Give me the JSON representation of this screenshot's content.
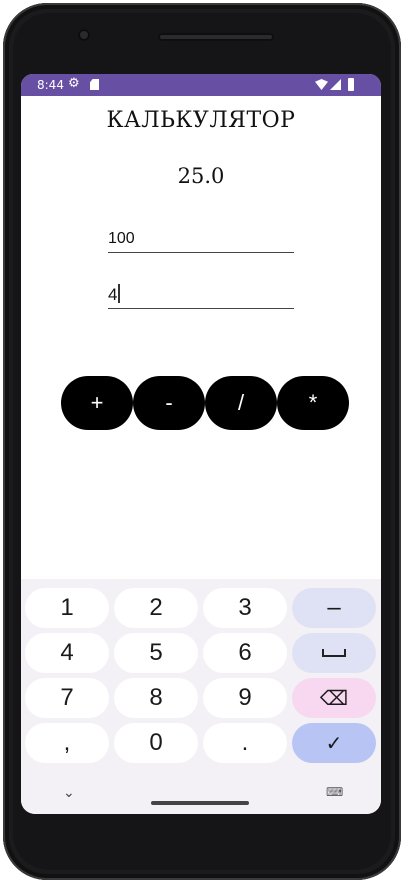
{
  "status_bar": {
    "time": "8:44",
    "icons": [
      "gear-icon",
      "sd-card-icon",
      "wifi-icon",
      "signal-icon",
      "battery-icon"
    ],
    "color": "#6750a4"
  },
  "app": {
    "title": "КАЛЬКУЛЯТОР",
    "result": "25.0",
    "input1": {
      "value": "100"
    },
    "input2": {
      "value": "4"
    },
    "operations": [
      "+",
      "-",
      "/",
      "*"
    ]
  },
  "keyboard": {
    "keys": {
      "k1": "1",
      "k2": "2",
      "k3": "3",
      "minus": "–",
      "k4": "4",
      "k5": "5",
      "k6": "6",
      "k7": "7",
      "k8": "8",
      "k9": "9",
      "comma": ",",
      "k0": "0",
      "dot": "."
    },
    "icons": [
      "space-icon",
      "backspace-icon",
      "checkmark-icon",
      "chevron-down-icon",
      "keyboard-icon"
    ]
  }
}
